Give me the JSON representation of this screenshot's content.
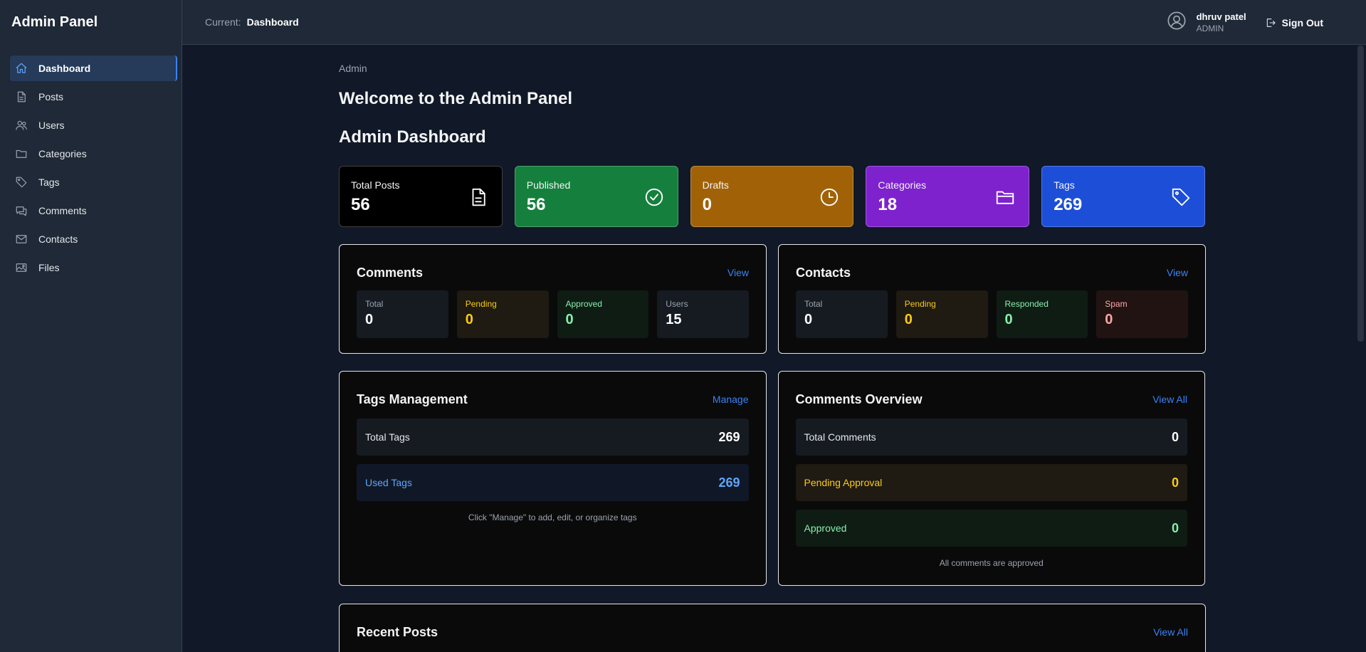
{
  "sidebar": {
    "brand": "Admin Panel",
    "items": [
      {
        "label": "Dashboard",
        "icon": "home-icon"
      },
      {
        "label": "Posts",
        "icon": "document-icon"
      },
      {
        "label": "Users",
        "icon": "users-icon"
      },
      {
        "label": "Categories",
        "icon": "folder-icon"
      },
      {
        "label": "Tags",
        "icon": "tag-icon"
      },
      {
        "label": "Comments",
        "icon": "chat-icon"
      },
      {
        "label": "Contacts",
        "icon": "mail-icon"
      },
      {
        "label": "Files",
        "icon": "image-icon"
      }
    ]
  },
  "header": {
    "current_label": "Current:",
    "current_page": "Dashboard",
    "user_name": "dhruv patel",
    "user_role": "ADMIN",
    "sign_out": "Sign Out"
  },
  "main": {
    "breadcrumb": "Admin",
    "welcome": "Welcome to the Admin Panel",
    "dashboard_title": "Admin Dashboard",
    "stats": [
      {
        "label": "Total Posts",
        "value": "56",
        "icon": "document-icon",
        "color": "#000000"
      },
      {
        "label": "Published",
        "value": "56",
        "icon": "check-circle-icon",
        "color": "#15803d"
      },
      {
        "label": "Drafts",
        "value": "0",
        "icon": "clock-icon",
        "color": "#a16207"
      },
      {
        "label": "Categories",
        "value": "18",
        "icon": "folder-icon",
        "color": "#7e22ce"
      },
      {
        "label": "Tags",
        "value": "269",
        "icon": "tag-icon",
        "color": "#1d4ed8"
      }
    ],
    "comments": {
      "title": "Comments",
      "link": "View",
      "items": [
        {
          "label": "Total",
          "value": "0"
        },
        {
          "label": "Pending",
          "value": "0"
        },
        {
          "label": "Approved",
          "value": "0"
        },
        {
          "label": "Users",
          "value": "15"
        }
      ]
    },
    "contacts": {
      "title": "Contacts",
      "link": "View",
      "items": [
        {
          "label": "Total",
          "value": "0"
        },
        {
          "label": "Pending",
          "value": "0"
        },
        {
          "label": "Responded",
          "value": "0"
        },
        {
          "label": "Spam",
          "value": "0"
        }
      ]
    },
    "tags_management": {
      "title": "Tags Management",
      "link": "Manage",
      "rows": [
        {
          "label": "Total Tags",
          "value": "269"
        },
        {
          "label": "Used Tags",
          "value": "269"
        }
      ],
      "note": "Click \"Manage\" to add, edit, or organize tags"
    },
    "comments_overview": {
      "title": "Comments Overview",
      "link": "View All",
      "rows": [
        {
          "label": "Total Comments",
          "value": "0"
        },
        {
          "label": "Pending Approval",
          "value": "0"
        },
        {
          "label": "Approved",
          "value": "0"
        }
      ],
      "note": "All comments are approved"
    },
    "recent_posts": {
      "title": "Recent Posts",
      "link": "View All"
    }
  }
}
